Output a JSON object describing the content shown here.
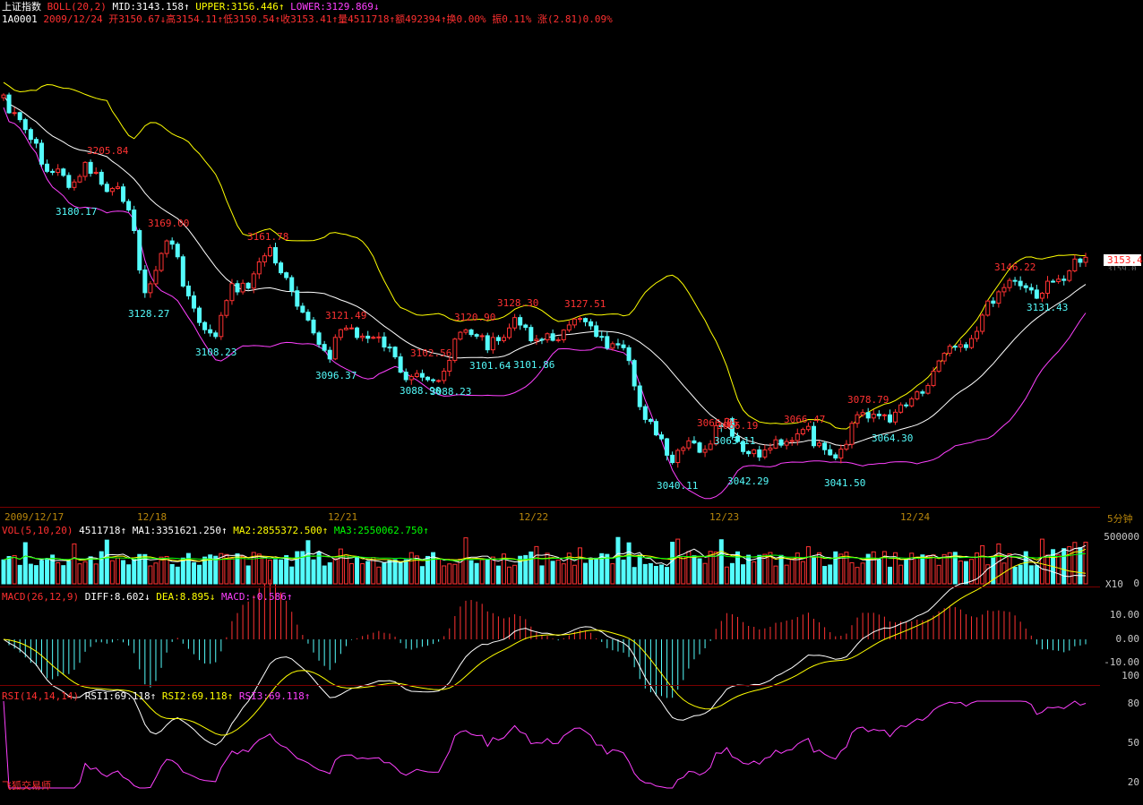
{
  "header": {
    "row1": [
      {
        "t": "上证指数",
        "c": "#ffffff"
      },
      {
        "t": " BOLL(20,2) ",
        "c": "#ff3030"
      },
      {
        "t": "MID:3143.158↑",
        "c": "#ffffff"
      },
      {
        "t": " UPPER:3156.446↑",
        "c": "#ffff00"
      },
      {
        "t": " LOWER:3129.869↓",
        "c": "#ff40ff"
      }
    ],
    "row2": [
      {
        "t": "1A0001",
        "c": "#ffffff"
      },
      {
        "t": " 2009/12/24 开3150.67↓高3154.11↑低3150.54↑收3153.41↑量4511718↑额492394↑换0.00% 振0.11% 涨(2.81)0.09%",
        "c": "#ff3030"
      }
    ]
  },
  "price_panel": {
    "last_price_tag": "3153.4",
    "last_price_tag_sub": "3159.0",
    "high_labels": [
      "3205.84",
      "3169.00",
      "3161.78",
      "3121.49",
      "3102.56",
      "3120.90",
      "3128.30",
      "3127.51",
      "3066.05",
      "3066.19",
      "3066.47",
      "3078.79",
      "3146.22"
    ],
    "low_labels": [
      "3180.17",
      "3128.27",
      "3108.23",
      "3096.37",
      "3088.90",
      "3088.23",
      "3101.64",
      "3101.86",
      "3063.11",
      "3040.11",
      "3042.29",
      "3041.50",
      "3064.30",
      "3131.43"
    ]
  },
  "date_axis": {
    "labels": [
      "2009/12/17",
      "12/18",
      "12/21",
      "12/22",
      "12/23",
      "12/24"
    ],
    "timeframe": "5分钟"
  },
  "vol_panel": {
    "header": [
      {
        "t": "VOL(5,10,20) ",
        "c": "#ff3030"
      },
      {
        "t": " 4511718↑",
        "c": "#ffffff"
      },
      {
        "t": " MA1:3351621.250↑",
        "c": "#ffffff"
      },
      {
        "t": " MA2:2855372.500↑",
        "c": "#ffff00"
      },
      {
        "t": " MA3:2550062.750↑",
        "c": "#00ff00"
      }
    ],
    "axis_top": "500000",
    "axis_bottom": "0",
    "unit": "X10"
  },
  "macd_panel": {
    "header": [
      {
        "t": "MACD(26,12,9) ",
        "c": "#ff3030"
      },
      {
        "t": " DIFF:8.602↓",
        "c": "#ffffff"
      },
      {
        "t": " DEA:8.895↓",
        "c": "#ffff00"
      },
      {
        "t": " MACD:-0.586↑",
        "c": "#ff40ff"
      }
    ],
    "axis": [
      "10.00",
      "0.00",
      "-10.00"
    ]
  },
  "rsi_panel": {
    "header": [
      {
        "t": "RSI(14,14,14) ",
        "c": "#ff3030"
      },
      {
        "t": " RSI1:69.118↑",
        "c": "#ffffff"
      },
      {
        "t": " RSI2:69.118↑",
        "c": "#ffff00"
      },
      {
        "t": " RSI3:69.118↑",
        "c": "#ff40ff"
      }
    ],
    "axis": [
      "100",
      "80",
      "50",
      "20"
    ]
  },
  "footer": {
    "brand": "飞狐交易师"
  },
  "colors": {
    "up": "#ff3232",
    "down": "#54fcfc",
    "mid": "#ffffff",
    "upper": "#ffff00",
    "lower": "#ff40ff",
    "rsi": "#ff40ff",
    "ma3": "#00ff00"
  }
}
